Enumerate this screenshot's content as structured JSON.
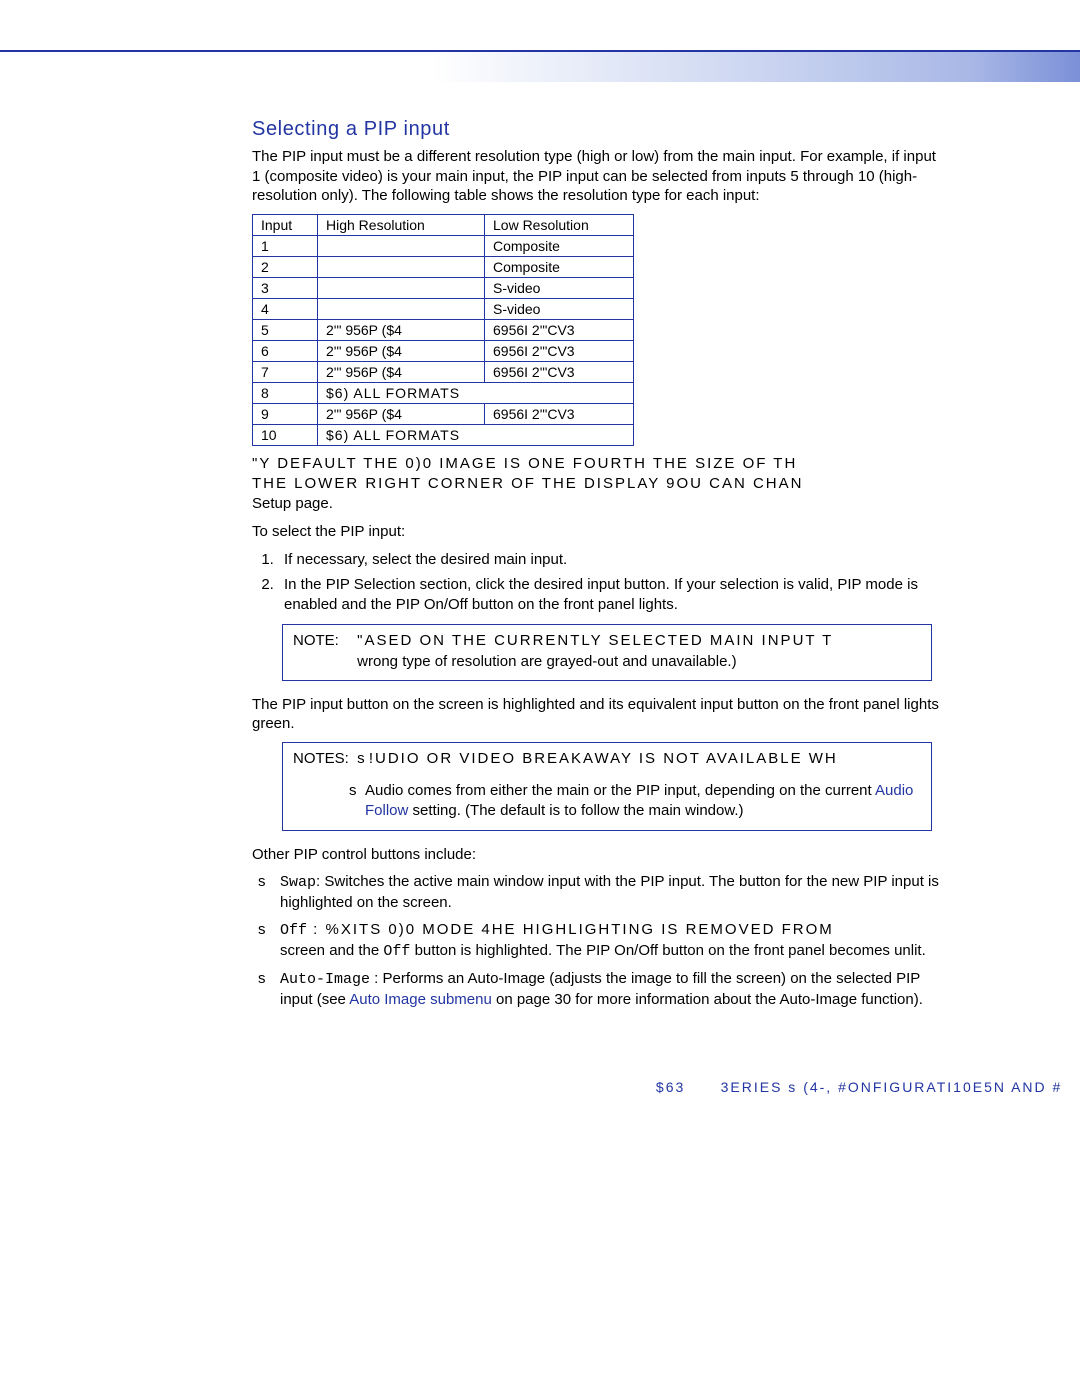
{
  "section_title": "Selecting a PIP input",
  "intro": "The PIP input must be a different resolution type (high or low) from the main input. For example, if input 1 (composite video) is your main input, the PIP input can be selected from inputs 5 through 10 (high-resolution only). The following table shows the resolution type for each input:",
  "table": {
    "headers": {
      "input": "Input",
      "high": "High Resolution",
      "low": "Low Resolution"
    },
    "rows": [
      {
        "input": "1",
        "high": "",
        "low": "Composite",
        "span": false
      },
      {
        "input": "2",
        "high": "",
        "low": "Composite",
        "span": false
      },
      {
        "input": "3",
        "high": "",
        "low": "S-video",
        "span": false
      },
      {
        "input": "4",
        "high": "",
        "low": "S-video",
        "span": false
      },
      {
        "input": "5",
        "high": "2'\"  956P ($4",
        "low": "6956I  2'\"CV3",
        "span": false
      },
      {
        "input": "6",
        "high": "2'\"  956P ($4",
        "low": "6956I  2'\"CV3",
        "span": false
      },
      {
        "input": "7",
        "high": "2'\"  956P ($4",
        "low": "6956I  2'\"CV3",
        "span": false
      },
      {
        "input": "8",
        "high": "$6)  ALL FORMATS",
        "low": "",
        "span": true
      },
      {
        "input": "9",
        "high": "2'\"  956P ($4",
        "low": "6956I  2'\"CV3",
        "span": false
      },
      {
        "input": "10",
        "high": "$6)  ALL FORMATS",
        "low": "",
        "span": true
      }
    ]
  },
  "default_line1": "\"Y DEFAULT THE 0)0 IMAGE IS ONE FOURTH THE SIZE OF TH",
  "default_line2": "THE LOWER RIGHT CORNER OF THE DISPLAY 9OU CAN CHAN",
  "default_line3": "Setup page.",
  "to_select": "To select the PIP input:",
  "steps": [
    "If necessary, select the desired main input.",
    "In the PIP Selection section, click the desired input button. If your selection is valid, PIP mode is enabled and the PIP On/Off button on the front panel lights."
  ],
  "note1": {
    "label": "NOTE:",
    "line1": "\"ASED ON THE CURRENTLY SELECTED MAIN INPUT T",
    "line2": "wrong type of resolution are grayed-out and unavailable.)"
  },
  "after_note1": "The PIP input button on the screen is highlighted and its equivalent input button on the front panel lights green.",
  "note2": {
    "label": "NOTES:",
    "line1": "!UDIO OR VIDEO BREAKAWAY IS NOT AVAILABLE WH",
    "item2_pre": "Audio comes from either the main or the PIP input, depending on the current ",
    "item2_link": "Audio Follow",
    "item2_post": " setting. (The default is to follow the main window.)"
  },
  "other_controls": "Other PIP control buttons include:",
  "bullets": {
    "swap_label": "Swap",
    "swap_text": ": Switches the active main window input with the PIP input. The button for the new PIP input is highlighted on the screen.",
    "off_label": "Off",
    "off_text1": " : %XITS 0)0 MODE 4HE HIGHLIGHTING IS REMOVED FROM",
    "off_text2": "screen and the ",
    "off_text2b": "Off",
    "off_text2c": " button is highlighted. The PIP On/Off button on the front panel becomes unlit.",
    "auto_label": "Auto-Image",
    "auto_text1": " : Performs an Auto-Image (adjusts the image to fill the screen) on the selected PIP input (see ",
    "auto_link": "Auto Image submenu",
    "auto_text2": " on page 30 for more information about the Auto-Image function)."
  },
  "footer": {
    "left": "$63",
    "right": "3ERIES s (4-, #ONFIGURATI10E5N AND #"
  }
}
